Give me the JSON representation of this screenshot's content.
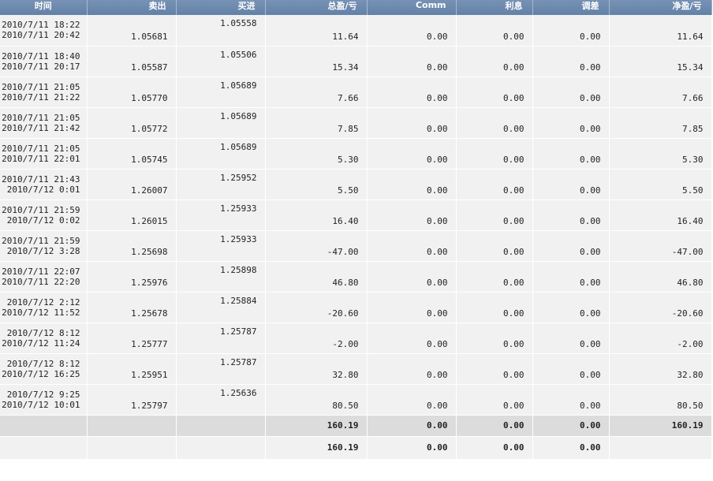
{
  "headers": {
    "time": "时间",
    "sell": "卖出",
    "buy": "买进",
    "gross": "总盈/亏",
    "comm": "Comm",
    "interest": "利息",
    "adjust": "调差",
    "net": "净盈/亏"
  },
  "trades": [
    {
      "open": "2010/7/11 18:22",
      "close": "2010/7/11 20:42",
      "sell": "1.05681",
      "buy": "1.05558",
      "gross": "11.64",
      "comm": "0.00",
      "interest": "0.00",
      "adjust": "0.00",
      "net": "11.64"
    },
    {
      "open": "2010/7/11 18:40",
      "close": "2010/7/11 20:17",
      "sell": "1.05587",
      "buy": "1.05506",
      "gross": "15.34",
      "comm": "0.00",
      "interest": "0.00",
      "adjust": "0.00",
      "net": "15.34"
    },
    {
      "open": "2010/7/11 21:05",
      "close": "2010/7/11 21:22",
      "sell": "1.05770",
      "buy": "1.05689",
      "gross": "7.66",
      "comm": "0.00",
      "interest": "0.00",
      "adjust": "0.00",
      "net": "7.66"
    },
    {
      "open": "2010/7/11 21:05",
      "close": "2010/7/11 21:42",
      "sell": "1.05772",
      "buy": "1.05689",
      "gross": "7.85",
      "comm": "0.00",
      "interest": "0.00",
      "adjust": "0.00",
      "net": "7.85"
    },
    {
      "open": "2010/7/11 21:05",
      "close": "2010/7/11 22:01",
      "sell": "1.05745",
      "buy": "1.05689",
      "gross": "5.30",
      "comm": "0.00",
      "interest": "0.00",
      "adjust": "0.00",
      "net": "5.30"
    },
    {
      "open": "2010/7/11 21:43",
      "close": "2010/7/12 0:01",
      "sell": "1.26007",
      "buy": "1.25952",
      "gross": "5.50",
      "comm": "0.00",
      "interest": "0.00",
      "adjust": "0.00",
      "net": "5.50"
    },
    {
      "open": "2010/7/11 21:59",
      "close": "2010/7/12 0:02",
      "sell": "1.26015",
      "buy": "1.25933",
      "gross": "16.40",
      "comm": "0.00",
      "interest": "0.00",
      "adjust": "0.00",
      "net": "16.40"
    },
    {
      "open": "2010/7/11 21:59",
      "close": "2010/7/12 3:28",
      "sell": "1.25698",
      "buy": "1.25933",
      "gross": "-47.00",
      "comm": "0.00",
      "interest": "0.00",
      "adjust": "0.00",
      "net": "-47.00"
    },
    {
      "open": "2010/7/11 22:07",
      "close": "2010/7/11 22:20",
      "sell": "1.25976",
      "buy": "1.25898",
      "gross": "46.80",
      "comm": "0.00",
      "interest": "0.00",
      "adjust": "0.00",
      "net": "46.80"
    },
    {
      "open": "2010/7/12 2:12",
      "close": "2010/7/12 11:52",
      "sell": "1.25678",
      "buy": "1.25884",
      "gross": "-20.60",
      "comm": "0.00",
      "interest": "0.00",
      "adjust": "0.00",
      "net": "-20.60"
    },
    {
      "open": "2010/7/12 8:12",
      "close": "2010/7/12 11:24",
      "sell": "1.25777",
      "buy": "1.25787",
      "gross": "-2.00",
      "comm": "0.00",
      "interest": "0.00",
      "adjust": "0.00",
      "net": "-2.00"
    },
    {
      "open": "2010/7/12 8:12",
      "close": "2010/7/12 16:25",
      "sell": "1.25951",
      "buy": "1.25787",
      "gross": "32.80",
      "comm": "0.00",
      "interest": "0.00",
      "adjust": "0.00",
      "net": "32.80"
    },
    {
      "open": "2010/7/12 9:25",
      "close": "2010/7/12 10:01",
      "sell": "1.25797",
      "buy": "1.25636",
      "gross": "80.50",
      "comm": "0.00",
      "interest": "0.00",
      "adjust": "0.00",
      "net": "80.50"
    }
  ],
  "subtotal": {
    "gross": "160.19",
    "comm": "0.00",
    "interest": "0.00",
    "adjust": "0.00",
    "net": "160.19"
  },
  "total": {
    "gross": "160.19",
    "comm": "0.00",
    "interest": "0.00",
    "adjust": "0.00"
  },
  "colors": {
    "header_bg": "#6f8bb0",
    "row_bg": "#f1f1f1",
    "subtotal_bg": "#dcdcdc"
  }
}
